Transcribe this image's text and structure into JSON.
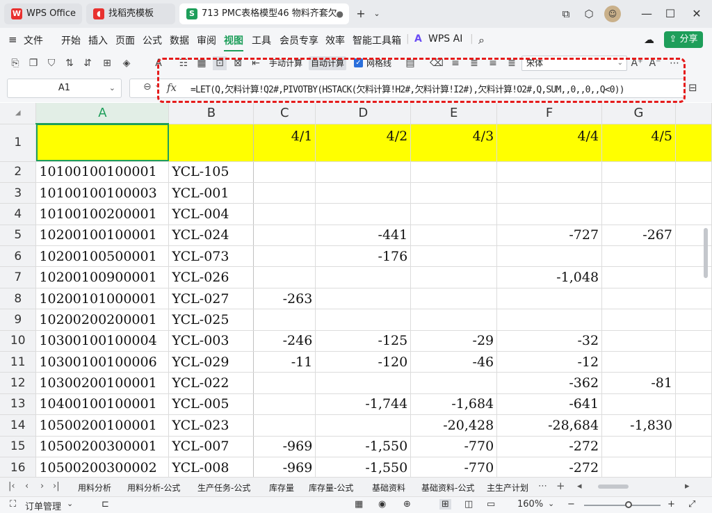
{
  "titlebar": {
    "tabs": [
      {
        "label": "WPS Office",
        "icon": "wps-logo-icon",
        "color": "#e8312f"
      },
      {
        "label": "找稻壳模板",
        "icon": "docer-icon",
        "color": "#e8312f"
      },
      {
        "label": "713 PMC表格模型46 物料齐套欠",
        "icon": "spreadsheet-icon",
        "color": "#1e9e5a"
      }
    ],
    "new_tab": "+",
    "window_controls": {
      "minimize": "—",
      "maximize": "☐",
      "close": "✕"
    }
  },
  "menubar": {
    "file": "文件",
    "items": [
      "开始",
      "插入",
      "页面",
      "公式",
      "数据",
      "审阅",
      "视图",
      "工具",
      "会员专享",
      "效率",
      "智能工具箱"
    ],
    "active": "视图",
    "wps_ai": "WPS AI",
    "share": "分享"
  },
  "toolbar": {
    "manual_calc": "手动计算",
    "auto_calc": "自动计算",
    "gridlines_label": "网格线",
    "gridlines_checked": true,
    "font_name": "宋体"
  },
  "formula_bar": {
    "cell_ref": "A1",
    "fx": "fx",
    "formula": "=LET(Q,欠料计算!Q2#,PIVOTBY(HSTACK(欠料计算!H2#,欠料计算!I2#),欠料计算!O2#,Q,SUM,,0,,0,,Q<0))"
  },
  "sheet": {
    "columns": [
      "A",
      "B",
      "C",
      "D",
      "E",
      "F",
      "G"
    ],
    "selected_column": "A",
    "header_row": {
      "row": "1",
      "dates": [
        "4/1",
        "4/2",
        "4/3",
        "4/4",
        "4/5"
      ]
    },
    "rows": [
      {
        "row": "2",
        "code": "10100100100001",
        "name": "YCL-105",
        "c": "",
        "d": "",
        "e": "",
        "f": "",
        "g": ""
      },
      {
        "row": "3",
        "code": "10100100100003",
        "name": "YCL-001",
        "c": "",
        "d": "",
        "e": "",
        "f": "",
        "g": ""
      },
      {
        "row": "4",
        "code": "10100100200001",
        "name": "YCL-004",
        "c": "",
        "d": "",
        "e": "",
        "f": "",
        "g": ""
      },
      {
        "row": "5",
        "code": "10200100100001",
        "name": "YCL-024",
        "c": "",
        "d": "-441",
        "e": "",
        "f": "-727",
        "g": "-267"
      },
      {
        "row": "6",
        "code": "10200100500001",
        "name": "YCL-073",
        "c": "",
        "d": "-176",
        "e": "",
        "f": "",
        "g": ""
      },
      {
        "row": "7",
        "code": "10200100900001",
        "name": "YCL-026",
        "c": "",
        "d": "",
        "e": "",
        "f": "-1,048",
        "g": ""
      },
      {
        "row": "8",
        "code": "10200101000001",
        "name": "YCL-027",
        "c": "-263",
        "d": "",
        "e": "",
        "f": "",
        "g": ""
      },
      {
        "row": "9",
        "code": "10200200200001",
        "name": "YCL-025",
        "c": "",
        "d": "",
        "e": "",
        "f": "",
        "g": ""
      },
      {
        "row": "10",
        "code": "10300100100004",
        "name": "YCL-003",
        "c": "-246",
        "d": "-125",
        "e": "-29",
        "f": "-32",
        "g": ""
      },
      {
        "row": "11",
        "code": "10300100100006",
        "name": "YCL-029",
        "c": "-11",
        "d": "-120",
        "e": "-46",
        "f": "-12",
        "g": ""
      },
      {
        "row": "12",
        "code": "10300200100001",
        "name": "YCL-022",
        "c": "",
        "d": "",
        "e": "",
        "f": "-362",
        "g": "-81"
      },
      {
        "row": "13",
        "code": "10400100100001",
        "name": "YCL-005",
        "c": "",
        "d": "-1,744",
        "e": "-1,684",
        "f": "-641",
        "g": ""
      },
      {
        "row": "14",
        "code": "10500200100001",
        "name": "YCL-023",
        "c": "",
        "d": "",
        "e": "-20,428",
        "f": "-28,684",
        "g": "-1,830"
      },
      {
        "row": "15",
        "code": "10500200300001",
        "name": "YCL-007",
        "c": "-969",
        "d": "-1,550",
        "e": "-770",
        "f": "-272",
        "g": ""
      },
      {
        "row": "16",
        "code": "10500200300002",
        "name": "YCL-008",
        "c": "-969",
        "d": "-1,550",
        "e": "-770",
        "f": "-272",
        "g": ""
      }
    ]
  },
  "sheet_tabs": [
    "用料分析",
    "用料分析-公式",
    "生产任务-公式",
    "库存量",
    "库存量-公式",
    "基础资料",
    "基础资料-公式",
    "主生产计划"
  ],
  "statusbar": {
    "sheet_name": "订单管理",
    "zoom": "160%"
  }
}
